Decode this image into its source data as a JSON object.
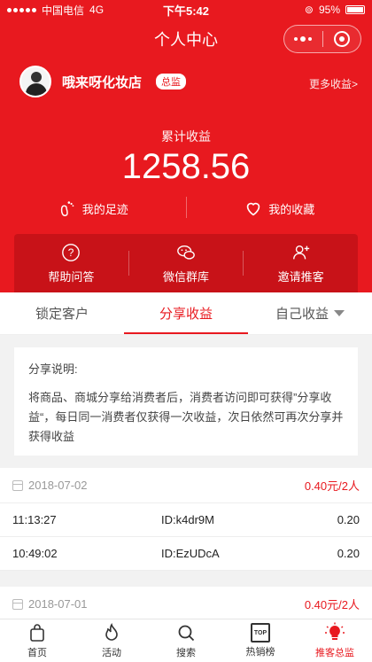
{
  "status_bar": {
    "carrier": "中国电信",
    "network": "4G",
    "time": "下午5:42",
    "battery": "95%"
  },
  "nav": {
    "title": "个人中心"
  },
  "profile": {
    "shop_name": "哦来呀化妆店",
    "badge": "总监",
    "more_income": "更多收益>"
  },
  "income": {
    "label": "累计收益",
    "value": "1258.56"
  },
  "quick": [
    {
      "label": "我的足迹",
      "icon": "footprint-icon"
    },
    {
      "label": "我的收藏",
      "icon": "heart-icon"
    }
  ],
  "tools": [
    {
      "label": "帮助问答",
      "icon": "help-icon"
    },
    {
      "label": "微信群库",
      "icon": "wechat-icon"
    },
    {
      "label": "邀请推客",
      "icon": "invite-user-icon"
    }
  ],
  "tabs": [
    "锁定客户",
    "分享收益",
    "自己收益"
  ],
  "active_tab": "分享收益",
  "notice": {
    "title": "分享说明:",
    "text": "将商品、商城分享给消费者后，消费者访问即可获得”分享收益“，每日同一消费者仅获得一次收益，次日依然可再次分享并获得收益"
  },
  "groups": [
    {
      "date": "2018-07-02",
      "summary": "0.40元/2人",
      "rows": [
        {
          "time": "11:13:27",
          "id": "ID:k4dr9M",
          "amount": "0.20"
        },
        {
          "time": "10:49:02",
          "id": "ID:EzUDcA",
          "amount": "0.20"
        }
      ]
    },
    {
      "date": "2018-07-01",
      "summary": "0.40元/2人",
      "rows": []
    }
  ],
  "tabbar": [
    {
      "label": "首页",
      "icon": "bag-icon"
    },
    {
      "label": "活动",
      "icon": "flame-icon"
    },
    {
      "label": "搜索",
      "icon": "search-icon"
    },
    {
      "label": "热销榜",
      "icon": "top-icon",
      "badge_text": "TOP"
    },
    {
      "label": "推客总监",
      "icon": "bulb-icon"
    }
  ],
  "colors": {
    "brand": "#e8191f",
    "brand_dark": "#c81218"
  }
}
